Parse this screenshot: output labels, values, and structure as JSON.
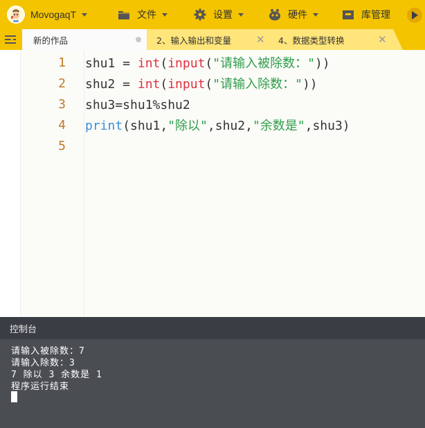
{
  "app": {
    "user_name": "MovogaqT",
    "accent_color": "#f5c400"
  },
  "menu": {
    "file_label": "文件",
    "settings_label": "设置",
    "hardware_label": "硬件",
    "library_label": "库管理"
  },
  "tabs": [
    {
      "label": "新的作品",
      "active": true,
      "modified": true
    },
    {
      "label": "2、输入输出和变量",
      "active": false
    },
    {
      "label": "4、数据类型转换",
      "active": false
    }
  ],
  "editor": {
    "line_numbers": [
      "1",
      "2",
      "3",
      "4",
      "5"
    ],
    "lines": [
      [
        {
          "t": "shu1 = ",
          "c": ""
        },
        {
          "t": "int",
          "c": "red"
        },
        {
          "t": "(",
          "c": ""
        },
        {
          "t": "input",
          "c": "red"
        },
        {
          "t": "(",
          "c": ""
        },
        {
          "t": "\"请输入被除数：\"",
          "c": "str"
        },
        {
          "t": "))",
          "c": ""
        }
      ],
      [
        {
          "t": "shu2 = ",
          "c": ""
        },
        {
          "t": "int",
          "c": "red"
        },
        {
          "t": "(",
          "c": ""
        },
        {
          "t": "input",
          "c": "red"
        },
        {
          "t": "(",
          "c": ""
        },
        {
          "t": "\"请输入除数：\"",
          "c": "str"
        },
        {
          "t": "))",
          "c": ""
        }
      ],
      [
        {
          "t": "shu3=shu1%shu2",
          "c": ""
        }
      ],
      [
        {
          "t": "print",
          "c": "blue"
        },
        {
          "t": "(shu1,",
          "c": ""
        },
        {
          "t": "\"除以\"",
          "c": "str"
        },
        {
          "t": ",shu2,",
          "c": ""
        },
        {
          "t": "\"余数是\"",
          "c": "str"
        },
        {
          "t": ",shu3)",
          "c": ""
        }
      ],
      []
    ],
    "active_line": 5
  },
  "console": {
    "title": "控制台",
    "lines": [
      "请输入被除数：7",
      "请输入除数：3",
      "7 除以 3 余数是 1",
      "程序运行结束"
    ]
  }
}
